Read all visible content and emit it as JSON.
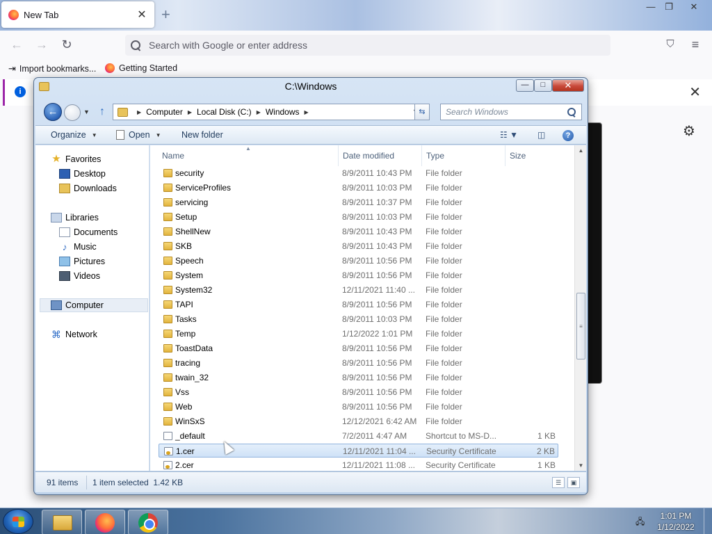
{
  "browser": {
    "tab_title": "New Tab",
    "tab_close": "✕",
    "new_tab": "+",
    "window_controls": {
      "minimize": "—",
      "restore": "❐",
      "close": "✕"
    },
    "url_placeholder": "Search with Google or enter address",
    "bookmarks": [
      {
        "label": "Import bookmarks..."
      },
      {
        "label": "Getting Started"
      }
    ],
    "infobar_close": "✕"
  },
  "explorer": {
    "title": "C:\\Windows",
    "controls": {
      "minimize": "—",
      "maximize": "□",
      "close": "✕"
    },
    "breadcrumb": [
      "Computer",
      "Local Disk (C:)",
      "Windows"
    ],
    "search_placeholder": "Search Windows",
    "commands": {
      "organize": "Organize",
      "open": "Open",
      "new_folder": "New folder"
    },
    "nav": {
      "favorites": "Favorites",
      "desktop": "Desktop",
      "downloads": "Downloads",
      "libraries": "Libraries",
      "documents": "Documents",
      "music": "Music",
      "pictures": "Pictures",
      "videos": "Videos",
      "computer": "Computer",
      "network": "Network"
    },
    "columns": {
      "name": "Name",
      "date": "Date modified",
      "type": "Type",
      "size": "Size"
    },
    "rows": [
      {
        "name": "security",
        "date": "8/9/2011 10:43 PM",
        "type": "File folder",
        "size": "",
        "kind": "folder"
      },
      {
        "name": "ServiceProfiles",
        "date": "8/9/2011 10:03 PM",
        "type": "File folder",
        "size": "",
        "kind": "folder"
      },
      {
        "name": "servicing",
        "date": "8/9/2011 10:37 PM",
        "type": "File folder",
        "size": "",
        "kind": "folder"
      },
      {
        "name": "Setup",
        "date": "8/9/2011 10:03 PM",
        "type": "File folder",
        "size": "",
        "kind": "folder"
      },
      {
        "name": "ShellNew",
        "date": "8/9/2011 10:43 PM",
        "type": "File folder",
        "size": "",
        "kind": "folder"
      },
      {
        "name": "SKB",
        "date": "8/9/2011 10:43 PM",
        "type": "File folder",
        "size": "",
        "kind": "folder"
      },
      {
        "name": "Speech",
        "date": "8/9/2011 10:56 PM",
        "type": "File folder",
        "size": "",
        "kind": "folder"
      },
      {
        "name": "System",
        "date": "8/9/2011 10:56 PM",
        "type": "File folder",
        "size": "",
        "kind": "folder"
      },
      {
        "name": "System32",
        "date": "12/11/2021 11:40 ...",
        "type": "File folder",
        "size": "",
        "kind": "folder"
      },
      {
        "name": "TAPI",
        "date": "8/9/2011 10:56 PM",
        "type": "File folder",
        "size": "",
        "kind": "folder"
      },
      {
        "name": "Tasks",
        "date": "8/9/2011 10:03 PM",
        "type": "File folder",
        "size": "",
        "kind": "folder"
      },
      {
        "name": "Temp",
        "date": "1/12/2022 1:01 PM",
        "type": "File folder",
        "size": "",
        "kind": "folder"
      },
      {
        "name": "ToastData",
        "date": "8/9/2011 10:56 PM",
        "type": "File folder",
        "size": "",
        "kind": "folder"
      },
      {
        "name": "tracing",
        "date": "8/9/2011 10:56 PM",
        "type": "File folder",
        "size": "",
        "kind": "folder"
      },
      {
        "name": "twain_32",
        "date": "8/9/2011 10:56 PM",
        "type": "File folder",
        "size": "",
        "kind": "folder"
      },
      {
        "name": "Vss",
        "date": "8/9/2011 10:56 PM",
        "type": "File folder",
        "size": "",
        "kind": "folder"
      },
      {
        "name": "Web",
        "date": "8/9/2011 10:56 PM",
        "type": "File folder",
        "size": "",
        "kind": "folder"
      },
      {
        "name": "WinSxS",
        "date": "12/12/2021 6:42 AM",
        "type": "File folder",
        "size": "",
        "kind": "folder"
      },
      {
        "name": "_default",
        "date": "7/2/2011 4:47 AM",
        "type": "Shortcut to MS-D...",
        "size": "1 KB",
        "kind": "shortcut"
      },
      {
        "name": "1.cer",
        "date": "12/11/2021 11:04 ...",
        "type": "Security Certificate",
        "size": "2 KB",
        "kind": "cert",
        "selected": true
      },
      {
        "name": "2.cer",
        "date": "12/11/2021 11:08 ...",
        "type": "Security Certificate",
        "size": "1 KB",
        "kind": "cert"
      }
    ],
    "status": {
      "count": "91 items",
      "selection": "1 item selected  1.42 KB"
    }
  },
  "taskbar": {
    "time": "1:01 PM",
    "date": "1/12/2022"
  }
}
